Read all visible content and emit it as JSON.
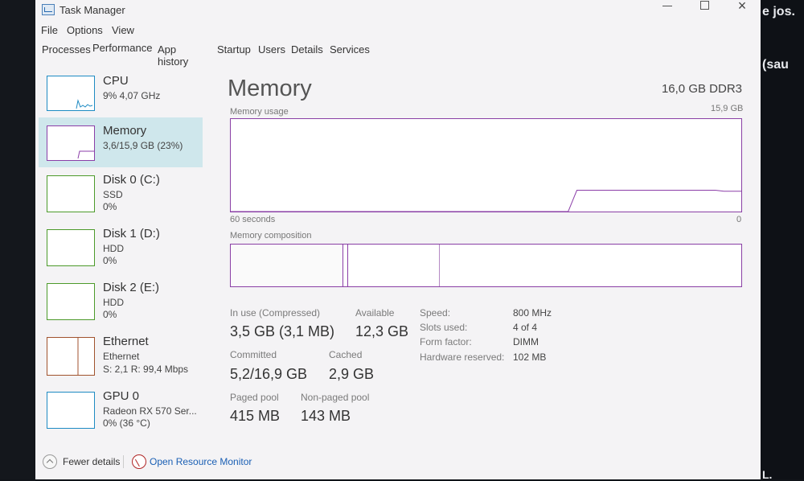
{
  "window": {
    "title": "Task Manager",
    "controls": {
      "minimize": "minimize",
      "maximize": "maximize",
      "close": "×"
    }
  },
  "menu": [
    "File",
    "Options",
    "View"
  ],
  "tabs": [
    "Processes",
    "Performance",
    "App history",
    "Startup",
    "Users",
    "Details",
    "Services"
  ],
  "sidebar": {
    "items": [
      {
        "title": "CPU",
        "line1": "9% 4,07 GHz",
        "line2": "",
        "color": "#1e8bc3",
        "selected": false
      },
      {
        "title": "Memory",
        "line1": "3,6/15,9 GB (23%)",
        "line2": "",
        "color": "#8b3ea8",
        "selected": true
      },
      {
        "title": "Disk 0 (C:)",
        "line1": "SSD",
        "line2": "0%",
        "color": "#4c9a2a",
        "selected": false
      },
      {
        "title": "Disk 1 (D:)",
        "line1": "HDD",
        "line2": "0%",
        "color": "#4c9a2a",
        "selected": false
      },
      {
        "title": "Disk 2 (E:)",
        "line1": "HDD",
        "line2": "0%",
        "color": "#4c9a2a",
        "selected": false
      },
      {
        "title": "Ethernet",
        "line1": "Ethernet",
        "line2": "S: 2,1  R: 99,4 Mbps",
        "color": "#a0522d",
        "selected": false
      },
      {
        "title": "GPU 0",
        "line1": "Radeon RX 570 Ser...",
        "line2": "0% (36 °C)",
        "color": "#1e8bc3",
        "selected": false
      }
    ]
  },
  "main": {
    "title": "Memory",
    "capacity": "16,0 GB DDR3",
    "usage_label": "Memory usage",
    "usage_max": "15,9 GB",
    "time_left": "60 seconds",
    "time_right": "0",
    "composition_label": "Memory composition",
    "accent_color": "#8b3ea8",
    "usage_history_fraction": [
      0,
      0,
      0,
      0,
      0,
      0,
      0,
      0,
      0,
      0,
      0,
      0,
      0,
      0,
      0,
      0,
      0,
      0,
      0,
      0,
      0,
      0,
      0,
      0,
      0,
      0,
      0,
      0,
      0,
      0,
      0,
      0,
      0,
      0,
      0,
      0,
      0,
      0,
      0,
      0,
      0.23,
      0.23,
      0.23,
      0.23,
      0.23,
      0.23,
      0.23,
      0.23,
      0.23,
      0.23,
      0.23,
      0.23,
      0.23,
      0.23,
      0.23,
      0.23,
      0.23,
      0.22,
      0.22,
      0.22
    ],
    "composition_fractions": {
      "in_use": 0.22,
      "modified": 0.01,
      "standby": 0.18,
      "free": 0.59
    },
    "stats": {
      "in_use_label": "In use (Compressed)",
      "in_use_value": "3,5 GB (3,1 MB)",
      "available_label": "Available",
      "available_value": "12,3 GB",
      "committed_label": "Committed",
      "committed_value": "5,2/16,9 GB",
      "cached_label": "Cached",
      "cached_value": "2,9 GB",
      "paged_label": "Paged pool",
      "paged_value": "415 MB",
      "nonpaged_label": "Non-paged pool",
      "nonpaged_value": "143 MB"
    },
    "specs": [
      {
        "label": "Speed:",
        "value": "800 MHz"
      },
      {
        "label": "Slots used:",
        "value": "4 of 4"
      },
      {
        "label": "Form factor:",
        "value": "DIMM"
      },
      {
        "label": "Hardware reserved:",
        "value": "102 MB"
      }
    ]
  },
  "footer": {
    "fewer_details": "Fewer details",
    "open_monitor": "Open Resource Monitor"
  },
  "background": {
    "text1": "e jos.",
    "text2": "(sau",
    "text3": "L."
  }
}
